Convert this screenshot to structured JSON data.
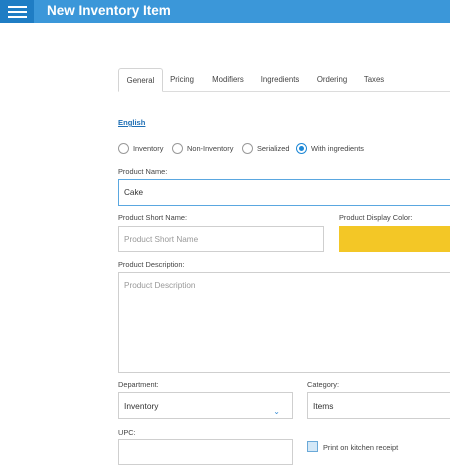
{
  "header": {
    "title": "New Inventory Item",
    "menu_icon": "hamburger-menu-icon"
  },
  "tabs": [
    {
      "label": "General",
      "active": true
    },
    {
      "label": "Pricing",
      "active": false
    },
    {
      "label": "Modifiers",
      "active": false
    },
    {
      "label": "Ingredients",
      "active": false
    },
    {
      "label": "Ordering",
      "active": false
    },
    {
      "label": "Taxes",
      "active": false
    }
  ],
  "language_link": "English",
  "item_type": {
    "options": [
      "Inventory",
      "Non-Inventory",
      "Serialized",
      "With ingredients"
    ],
    "selected": "With ingredients"
  },
  "product_name": {
    "label": "Product Name:",
    "value": "Cake"
  },
  "product_short_name": {
    "label": "Product Short Name:",
    "value": "",
    "placeholder": "Product Short Name"
  },
  "product_display_color": {
    "label": "Product Display Color:",
    "color": "#f3c726"
  },
  "product_description": {
    "label": "Product Description:",
    "value": "",
    "placeholder": "Product Description"
  },
  "department": {
    "label": "Department:",
    "value": "Inventory"
  },
  "category": {
    "label": "Category:",
    "value": "Items"
  },
  "upc": {
    "label": "UPC:",
    "value": ""
  },
  "print_on_kitchen_receipt": {
    "label": "Print on kitchen receipt",
    "checked": true
  },
  "colors": {
    "header": "#3b97d9",
    "menu_button": "#1f7dc4",
    "accent": "#1e88d6"
  }
}
